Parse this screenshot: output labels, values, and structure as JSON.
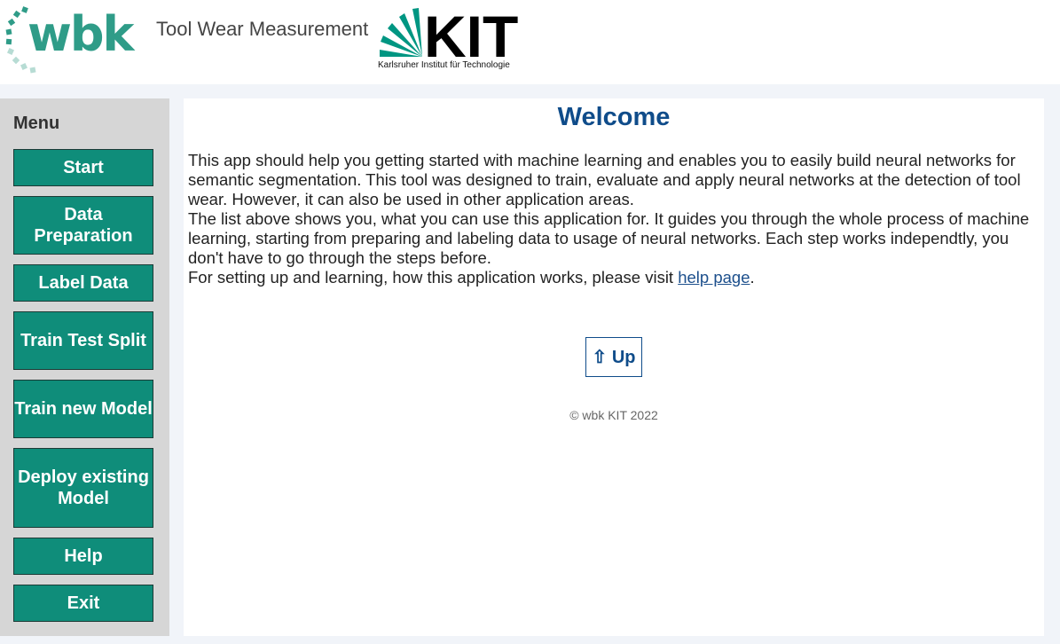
{
  "header": {
    "logo_text": "wbk",
    "app_title": "Tool Wear Measurement",
    "kit_logo_text": "KIT",
    "kit_subtitle": "Karlsruher Institut für Technologie"
  },
  "sidebar": {
    "title": "Menu",
    "items": [
      {
        "label": "Start"
      },
      {
        "label": "Data Preparation"
      },
      {
        "label": "Label Data"
      },
      {
        "label": "Train Test Split"
      },
      {
        "label": "Train new Model"
      },
      {
        "label": "Deploy existing Model"
      },
      {
        "label": "Help"
      },
      {
        "label": "Exit"
      }
    ]
  },
  "main": {
    "title": "Welcome",
    "paragraph1": "This app should help you getting started with machine learning and enables you to easily build neural networks for semantic segmentation. This tool was designed to train, evaluate and apply neural networks at the detection of tool wear. However, it can also be used in other application areas.",
    "paragraph2": "The list above shows you, what you can use this application for. It guides you through the whole process of machine learning, starting from preparing and labeling data to usage of neural networks. Each step works independtly, you don't have to go through the steps before.",
    "paragraph3_prefix": "For setting up and learning, how this application works, please visit ",
    "help_link": "help page",
    "paragraph3_suffix": ".",
    "up_button": "⇧ Up",
    "footer": "© wbk KIT 2022"
  },
  "colors": {
    "menu_button": "#0f8d7a",
    "title": "#0f4c8a",
    "wbk_green": "#2f9c88",
    "sidebar_bg": "#d6d6d6"
  }
}
